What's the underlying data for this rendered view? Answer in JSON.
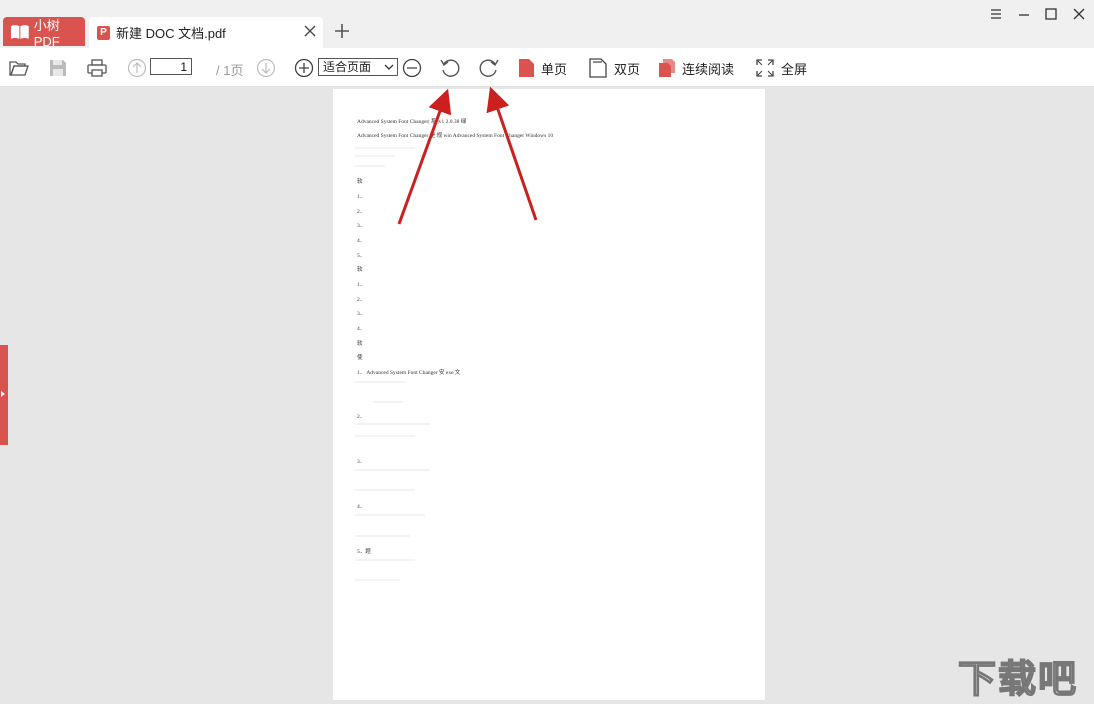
{
  "app": {
    "name": "小树PDF"
  },
  "tabs": [
    {
      "title": "新建 DOC 文档.pdf"
    }
  ],
  "toolbar": {
    "page_number": "1",
    "page_total": "/ 1页",
    "zoom_value": "适合页面",
    "single_page_label": "单页",
    "double_page_label": "双页",
    "continuous_label": "连续阅读",
    "fullscreen_label": "全屏"
  },
  "document": {
    "lines": [
      "Advanced System Font Changer| 系 |v1 2.0.38 绿",
      "Advanced System Font Changer 是 规 win Advanced System Font Changer Windows 10",
      "软",
      "1．",
      "2．",
      "3．",
      "4．",
      "5．",
      "软",
      "1．",
      "2．",
      "3．",
      "4．",
      "软",
      "使",
      "1． Advanced System Font Changer 安 exe 文",
      "2．",
      "3．",
      "4．",
      "5．题"
    ]
  },
  "watermark": "下载吧",
  "colors": {
    "accent": "#d9534f",
    "annotation_arrow": "#cc1f1f"
  }
}
